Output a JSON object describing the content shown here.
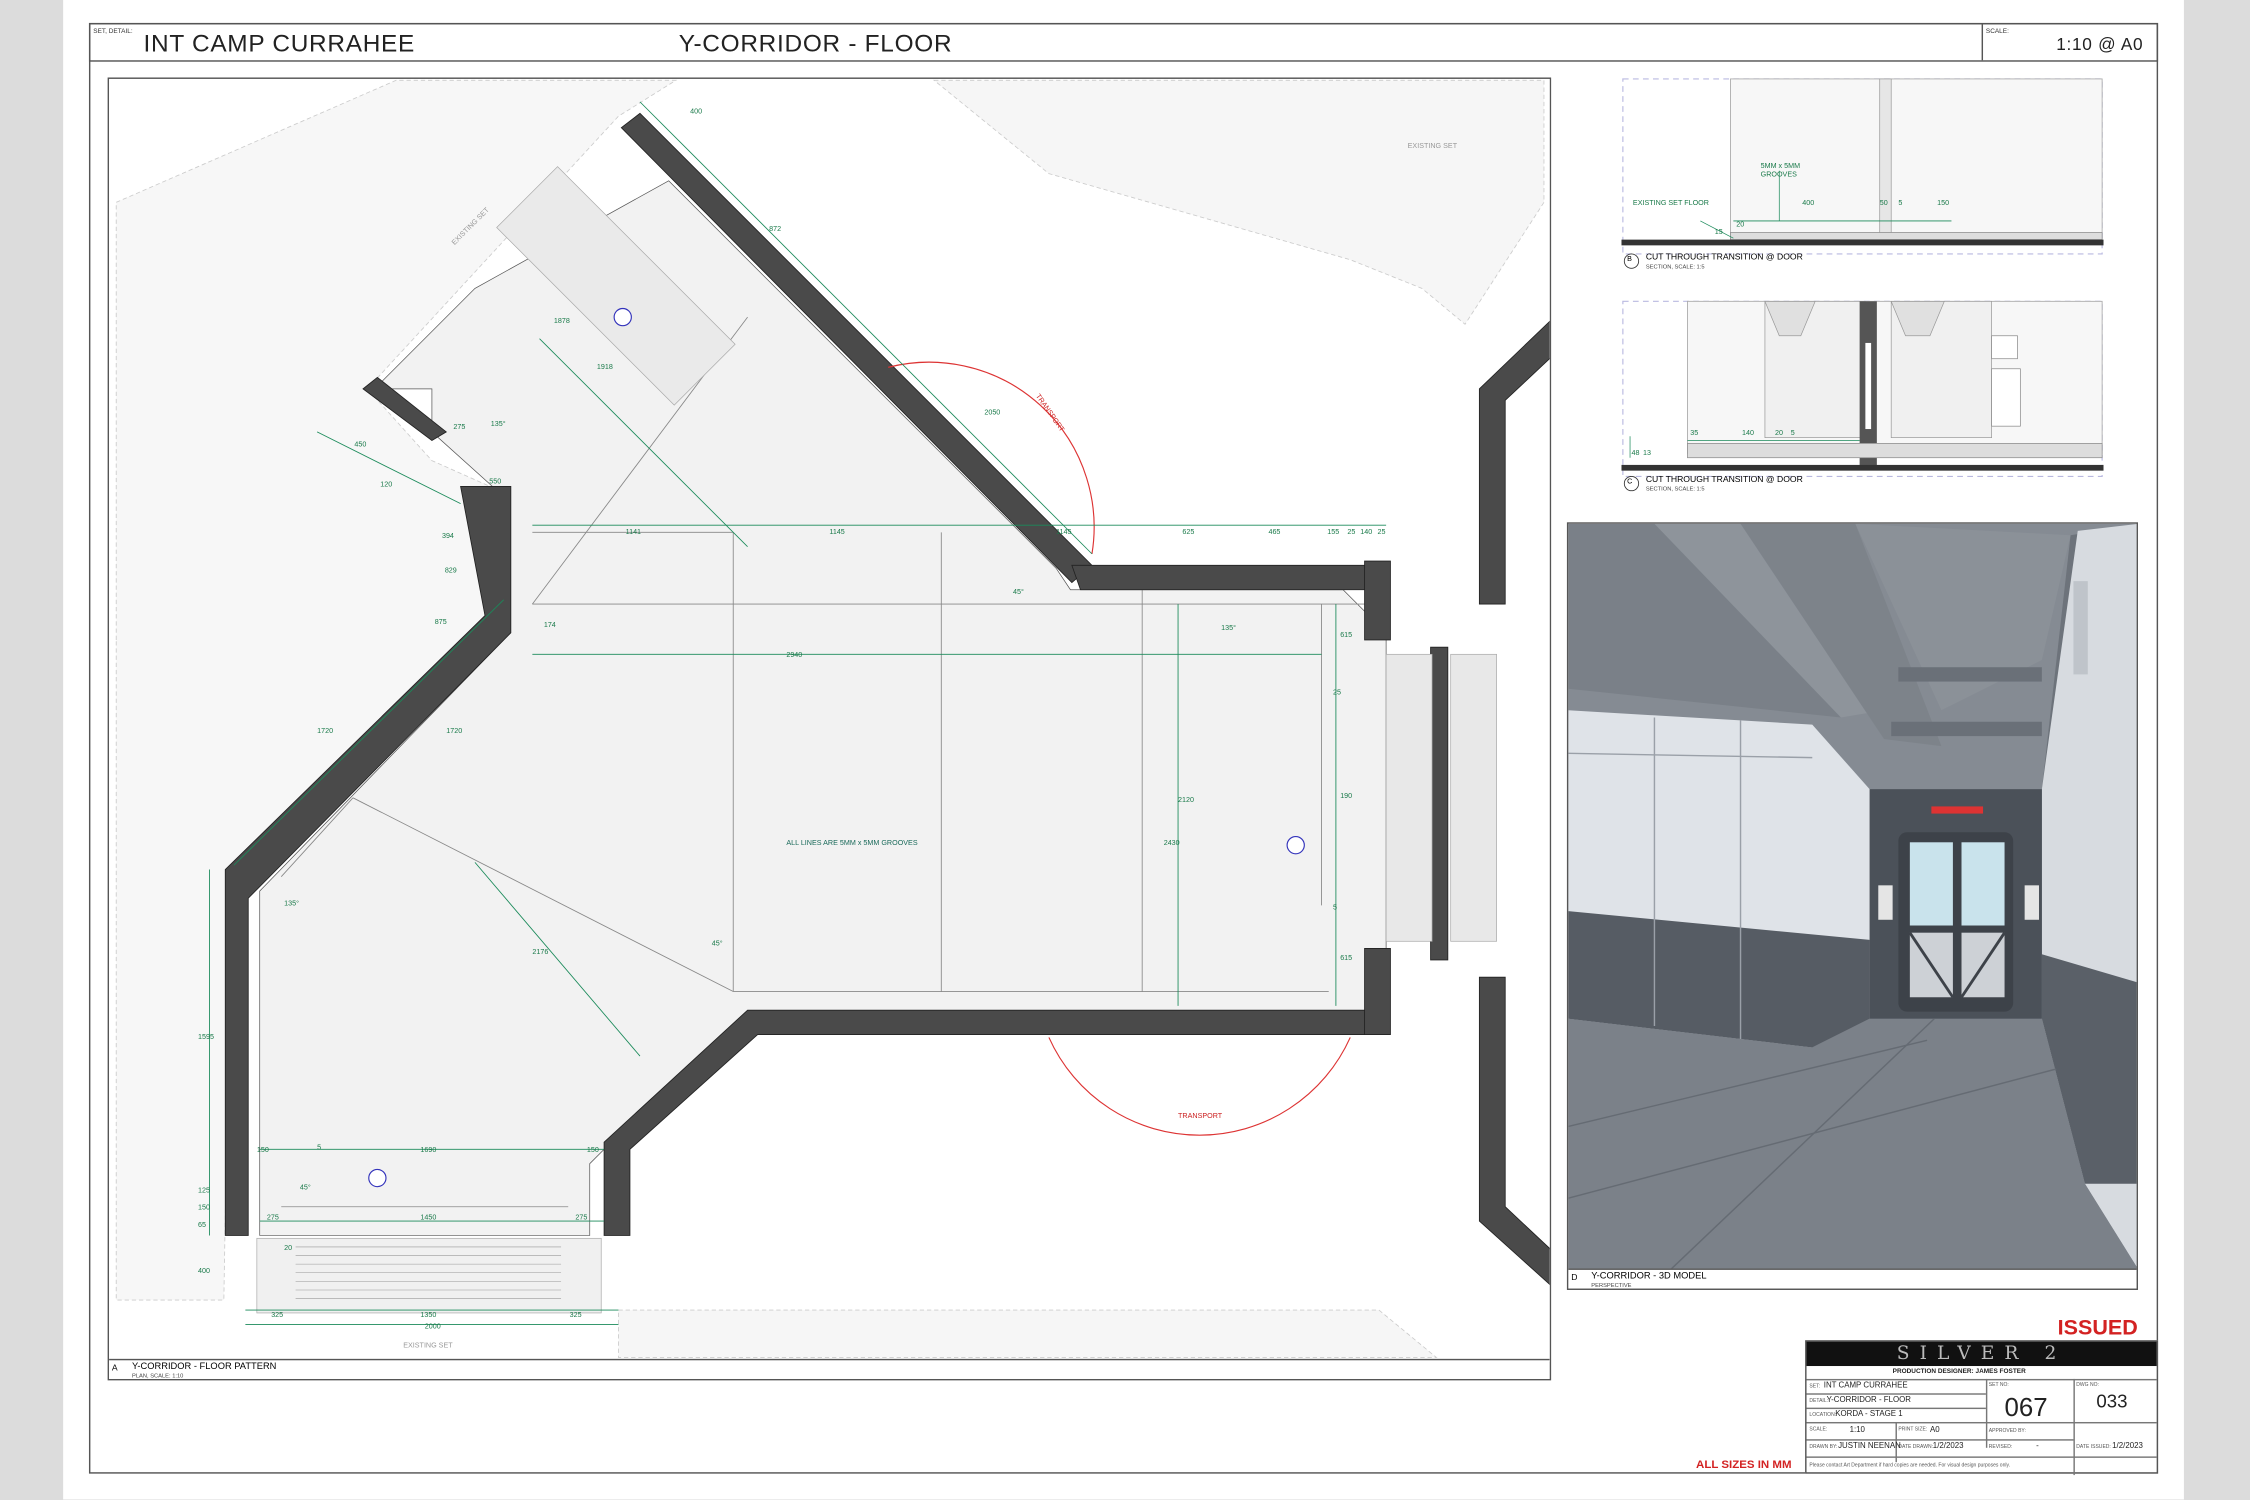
{
  "header": {
    "set_detail_label": "SET, DETAIL:",
    "set_name": "INT CAMP CURRAHEE",
    "detail_name": "Y-CORRIDOR - FLOOR",
    "scale_label": "SCALE:",
    "scale_value": "1:10  @ A0"
  },
  "plan": {
    "letter": "A",
    "title": "Y-CORRIDOR - FLOOR PATTERN",
    "subtitle": "PLAN, SCALE: 1:10",
    "existing_set_labels": [
      "EXISTING SET",
      "EXISTING SET",
      "EXISTING SET"
    ],
    "center_note": "ALL LINES ARE 5MM x 5MM GROOVES",
    "transport_labels": [
      "TRANSPORT",
      "TRANSPORT"
    ],
    "dimensions": [
      "1141",
      "1145",
      "1145",
      "625",
      "465",
      "155",
      "25",
      "140",
      "25",
      "2940",
      "174",
      "872",
      "2050",
      "1878",
      "1918",
      "1720",
      "1720",
      "2176",
      "2430",
      "2120",
      "615",
      "190",
      "615",
      "1690",
      "150",
      "150",
      "1450",
      "275",
      "275",
      "2000",
      "325",
      "1350",
      "325",
      "400",
      "1595",
      "125",
      "150",
      "65",
      "120",
      "550",
      "275",
      "875",
      "829",
      "394",
      "450",
      "400",
      "25",
      "5",
      "5",
      "135°",
      "135°",
      "135°",
      "45°",
      "45°",
      "45°",
      "20"
    ]
  },
  "section_b": {
    "letter": "B",
    "title": "CUT THROUGH TRANSITION @ DOOR",
    "subtitle": "SECTION, SCALE: 1:5",
    "note_grooves": "5MM x 5MM\nGROOVES",
    "note_existing": "EXISTING SET FLOOR",
    "dims": [
      "400",
      "50",
      "5",
      "150",
      "20",
      "15"
    ]
  },
  "section_c": {
    "letter": "C",
    "title": "CUT THROUGH TRANSITION @ DOOR",
    "subtitle": "SECTION, SCALE: 1:5",
    "dims": [
      "35",
      "140",
      "20",
      "5",
      "48",
      "13"
    ]
  },
  "model": {
    "letter": "D",
    "title": "Y-CORRIDOR - 3D MODEL",
    "subtitle": "PERSPECTIVE"
  },
  "issued": "ISSUED",
  "all_sizes": "ALL SIZES IN MM",
  "title_block": {
    "logo": "SILVER 2",
    "production_designer": "PRODUCTION DESIGNER: JAMES FOSTER",
    "set_label": "SET:",
    "set": "INT CAMP CURRAHEE",
    "detail_label": "DETAIL:",
    "detail": "Y-CORRIDOR - FLOOR",
    "location_label": "LOCATION:",
    "location": "KORDA - STAGE 1",
    "scale_label": "SCALE:",
    "scale": "1:10",
    "print_size_label": "PRINT SIZE:",
    "print_size": "A0",
    "set_no_label": "SET NO:",
    "set_no": "067",
    "dwg_no_label": "DWG NO:",
    "dwg_no": "033",
    "approved_label": "APPROVED BY:",
    "drawn_by_label": "DRAWN BY:",
    "drawn_by": "JUSTIN NEENAN",
    "date_drawn_label": "DATE DRAWN:",
    "date_drawn": "1/2/2023",
    "revised_label": "REVISED:",
    "revised": "-",
    "date_issued_label": "DATE ISSUED:",
    "date_issued": "1/2/2023",
    "footer_note": "Please contact Art Department if hard copies are needed. For visual design purposes only."
  }
}
